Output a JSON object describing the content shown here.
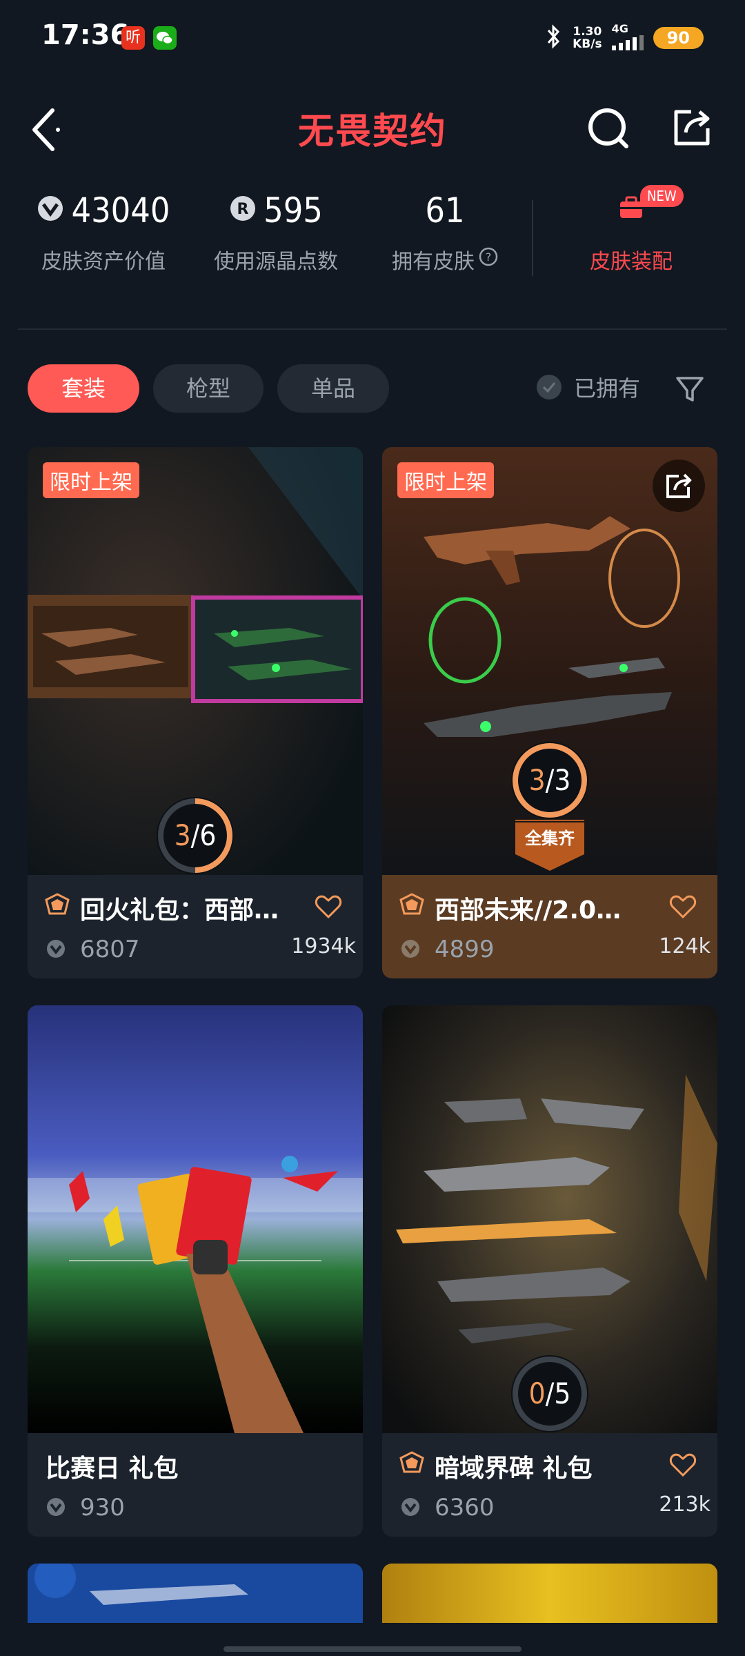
{
  "status_bar": {
    "time": "17:36",
    "apps": [
      {
        "icon": "ting-app-icon",
        "label": "听",
        "color": "#e8321f"
      },
      {
        "icon": "wechat-icon",
        "label": "",
        "color": "#1aad19"
      }
    ],
    "bluetooth": "bluetooth-icon",
    "speed_value": "1.30",
    "speed_unit": "KB/s",
    "network": "4G",
    "battery": "90"
  },
  "header": {
    "logo": "无畏契约",
    "back_icon": "back-arrow-icon",
    "search_icon": "search-icon",
    "share_icon": "share-icon"
  },
  "stats": [
    {
      "value": "43040",
      "label": "皮肤资产价值",
      "icon": "vp-icon"
    },
    {
      "value": "595",
      "label": "使用源晶点数",
      "icon": "radianite-icon"
    },
    {
      "value": "61",
      "label": "拥有皮肤",
      "icon": "help-icon"
    }
  ],
  "loadout": {
    "label": "皮肤装配",
    "badge": "NEW",
    "icon": "loadout-icon"
  },
  "tabs": [
    {
      "label": "套装",
      "active": true
    },
    {
      "label": "枪型",
      "active": false
    },
    {
      "label": "单品",
      "active": false
    }
  ],
  "owned_filter": {
    "label": "已拥有",
    "checked": false
  },
  "filter_icon": "filter-icon",
  "cards": [
    {
      "tag": "限时上架",
      "title": "回火礼包：西部…",
      "price": "6807",
      "count": "1934k",
      "progress_current": "3",
      "progress_total": "6",
      "progress": 0.5,
      "complete_label": ""
    },
    {
      "tag": "限时上架",
      "title": "西部未来//2.0…",
      "price": "4899",
      "count": "124k",
      "progress_current": "3",
      "progress_total": "3",
      "progress": 1.0,
      "complete_label": "全集齐"
    },
    {
      "tag": "",
      "title": "比赛日 礼包",
      "price": "930",
      "count": "",
      "progress_current": "",
      "progress_total": "",
      "progress": 0,
      "complete_label": ""
    },
    {
      "tag": "",
      "title": "暗域界碑 礼包",
      "price": "6360",
      "count": "213k",
      "progress_current": "0",
      "progress_total": "5",
      "progress": 0,
      "complete_label": ""
    }
  ],
  "colors": {
    "background": "#111821",
    "accent": "#ff4a4f",
    "tab_active": "#ff5a55",
    "progress_orange": "#f39a5c",
    "card_gold": "#5b3b22"
  }
}
